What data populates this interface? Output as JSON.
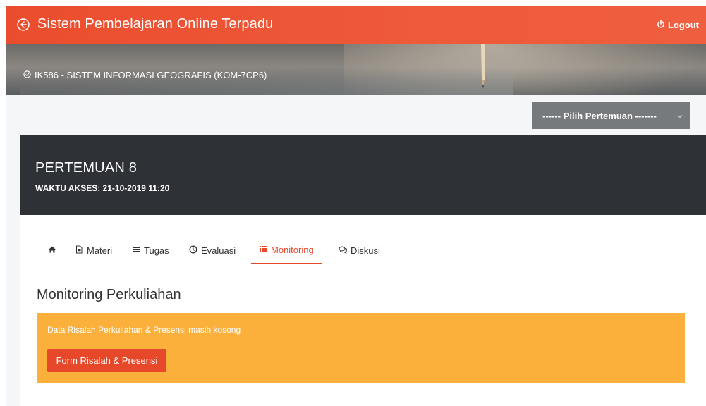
{
  "header": {
    "title": "Sistem Pembelajaran Online Terpadu",
    "logout_label": "Logout",
    "back_icon": "back-circle-icon",
    "logout_icon": "power-icon"
  },
  "course": {
    "label": "IK586 - SISTEM INFORMASI GEOGRAFIS (KOM-7CP6)",
    "icon": "check-circle-icon"
  },
  "meeting_select": {
    "selected": "------ Pilih Pertemuan -------"
  },
  "session": {
    "title": "PERTEMUAN 8",
    "access_time": "WAKTU AKSES: 21-10-2019 11:20"
  },
  "tabs": [
    {
      "label": "",
      "icon": "home-icon",
      "active": false
    },
    {
      "label": "Materi",
      "icon": "file-text-icon",
      "active": false
    },
    {
      "label": "Tugas",
      "icon": "tasks-icon",
      "active": false
    },
    {
      "label": "Evaluasi",
      "icon": "clock-icon",
      "active": false
    },
    {
      "label": "Monitoring",
      "icon": "list-icon",
      "active": true
    },
    {
      "label": "Diskusi",
      "icon": "comments-icon",
      "active": false
    }
  ],
  "monitoring": {
    "heading": "Monitoring Perkuliahan",
    "empty_message": "Data Risalah Perkuliahan & Presensi masih kosong",
    "form_button": "Form Risalah & Presensi"
  },
  "colors": {
    "accent": "#e8482a",
    "topbar": "#ee5a3a",
    "dark_card": "#2e3237",
    "alert": "#fbb03b",
    "selector": "#777a7d"
  }
}
